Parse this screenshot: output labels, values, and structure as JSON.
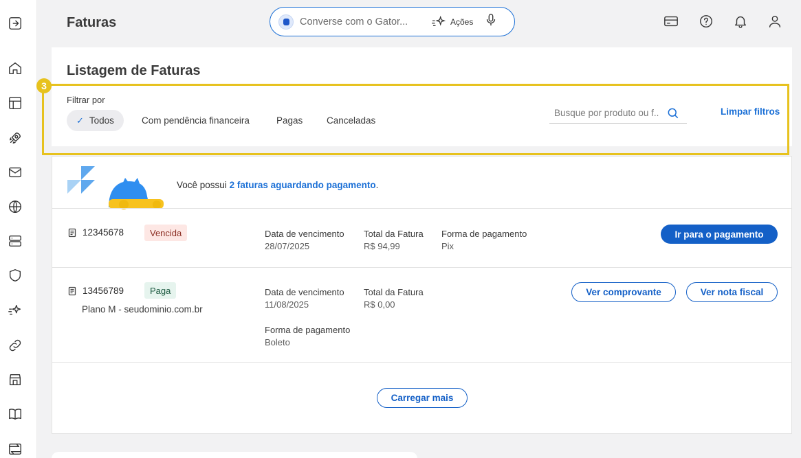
{
  "header": {
    "title": "Faturas",
    "chat": {
      "placeholder": "Converse com o Gator...",
      "actions_label": "Ações"
    }
  },
  "filters": {
    "section_title": "Listagem de Faturas",
    "label": "Filtrar por",
    "chips": [
      {
        "label": "Todos",
        "active": true
      },
      {
        "label": "Com pendência financeira",
        "active": false
      },
      {
        "label": "Pagas",
        "active": false
      },
      {
        "label": "Canceladas",
        "active": false
      }
    ],
    "search_placeholder": "Busque por produto ou f...",
    "clear_label": "Limpar filtros",
    "step_number": "3"
  },
  "notice": {
    "prefix": "Você possui ",
    "link": "2 faturas aguardando pagamento",
    "suffix": "."
  },
  "invoices": [
    {
      "number": "12345678",
      "status": "Vencida",
      "due_label": "Data de vencimento",
      "due_date": "28/07/2025",
      "total_label": "Total da Fatura",
      "total": "R$ 94,99",
      "payment_label": "Forma de pagamento",
      "payment": "Pix",
      "action": "Ir para o pagamento"
    },
    {
      "number": "13456789",
      "status": "Paga",
      "plan": "Plano M - seudominio.com.br",
      "due_label": "Data de vencimento",
      "due_date": "11/08/2025",
      "total_label": "Total da Fatura",
      "total": "R$ 0,00",
      "payment_label": "Forma de pagamento",
      "payment": "Boleto",
      "action_receipt": "Ver comprovante",
      "action_invoice": "Ver nota fiscal"
    }
  ],
  "load_more": "Carregar mais",
  "colors": {
    "primary": "#1460c7",
    "highlight": "#e7c21e",
    "overdue_bg": "#fde7e4",
    "paid_bg": "#e6f4ee"
  }
}
